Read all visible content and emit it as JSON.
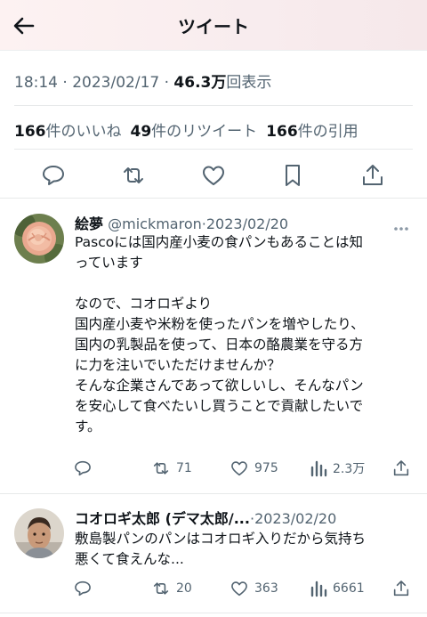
{
  "header": {
    "title": "ツイート"
  },
  "tweet": {
    "time": "18:14",
    "date": "2023/02/17",
    "views_count": "46.3万",
    "views_label": "回表示",
    "likes_count": "166",
    "likes_label": "件のいいね",
    "retweets_count": "49",
    "retweets_label": "件のリツイート",
    "quotes_count": "166",
    "quotes_label": "件の引用",
    "actions": [
      "reply-icon",
      "retweet-icon",
      "like-icon",
      "bookmark-icon",
      "share-icon"
    ]
  },
  "replies": [
    {
      "name": "絵夢",
      "handle": "@mickmaron",
      "date": "2023/02/20",
      "text_lines": [
        "Pascoには国内産小麦の食パンもあることは知",
        "っています",
        "",
        "なので、コオロギより",
        "国内産小麦や米粉を使ったパンを増やしたり、",
        "国内の乳製品を使って、日本の酪農業を守る方",
        "に力を注いでいただけませんか？",
        "そんな企業さんであって欲しいし、そんなパン",
        "を安心して食べたいし買うことで貢献したいで",
        "す。"
      ],
      "retweets": "71",
      "likes": "975",
      "views": "2.3万"
    },
    {
      "name": "コオロギ太郎 (デマ太郎/...",
      "handle": "",
      "date": "2023/02/20",
      "text_lines": [
        "敷島製パンのパンはコオロギ入りだから気持ち",
        "悪くて食えんな..."
      ],
      "retweets": "20",
      "likes": "363",
      "views": "6661"
    }
  ]
}
